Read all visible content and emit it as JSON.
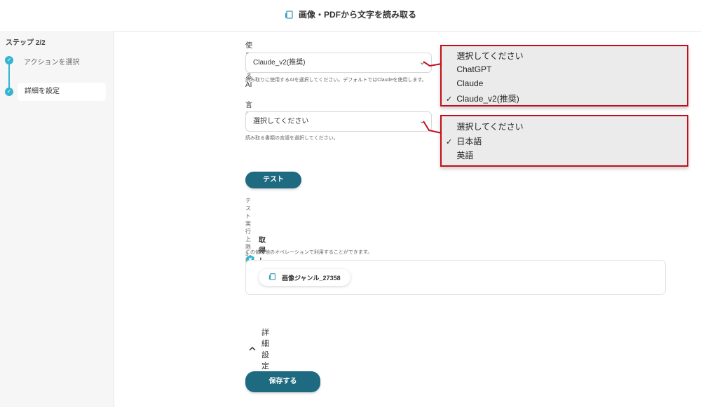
{
  "header": {
    "title": "画像・PDFから文字を読み取る",
    "icon": "image-pdf-icon"
  },
  "sidebar": {
    "step_label": "ステップ 2/2",
    "steps": [
      {
        "label": "アクションを選択",
        "state": "done"
      },
      {
        "label": "詳細を設定",
        "state": "current"
      }
    ]
  },
  "form": {
    "ai": {
      "label": "使用するAI",
      "value": "Claude_v2(推奨)",
      "helper": "読み取りに使用するAIを選択してください。デフォルトではClaudeを使用します。",
      "options": [
        {
          "label": "選択してください",
          "checked": false
        },
        {
          "label": "ChatGPT",
          "checked": false
        },
        {
          "label": "Claude",
          "checked": false
        },
        {
          "label": "Claude_v2(推奨)",
          "checked": true
        }
      ]
    },
    "language": {
      "label": "言語",
      "value": "選択してください",
      "helper": "読み取る書類の言語を選択してください。",
      "options": [
        {
          "label": "選択してください",
          "checked": false
        },
        {
          "label": "日本語",
          "checked": true
        },
        {
          "label": "英語",
          "checked": false
        }
      ]
    }
  },
  "test": {
    "button_label": "テスト",
    "limit_text": "テスト実行上限 3回 / 1時間"
  },
  "result": {
    "title": "取得した値",
    "helper": "この値を他のオペレーションで利用することができます。",
    "chip_label": "画像ジャンル_27358"
  },
  "advanced": {
    "label": "詳細設定"
  },
  "save": {
    "button_label": "保存する"
  },
  "colors": {
    "accent": "#1e6a80",
    "step": "#35b3d1",
    "highlight_border": "#c40d1a"
  }
}
